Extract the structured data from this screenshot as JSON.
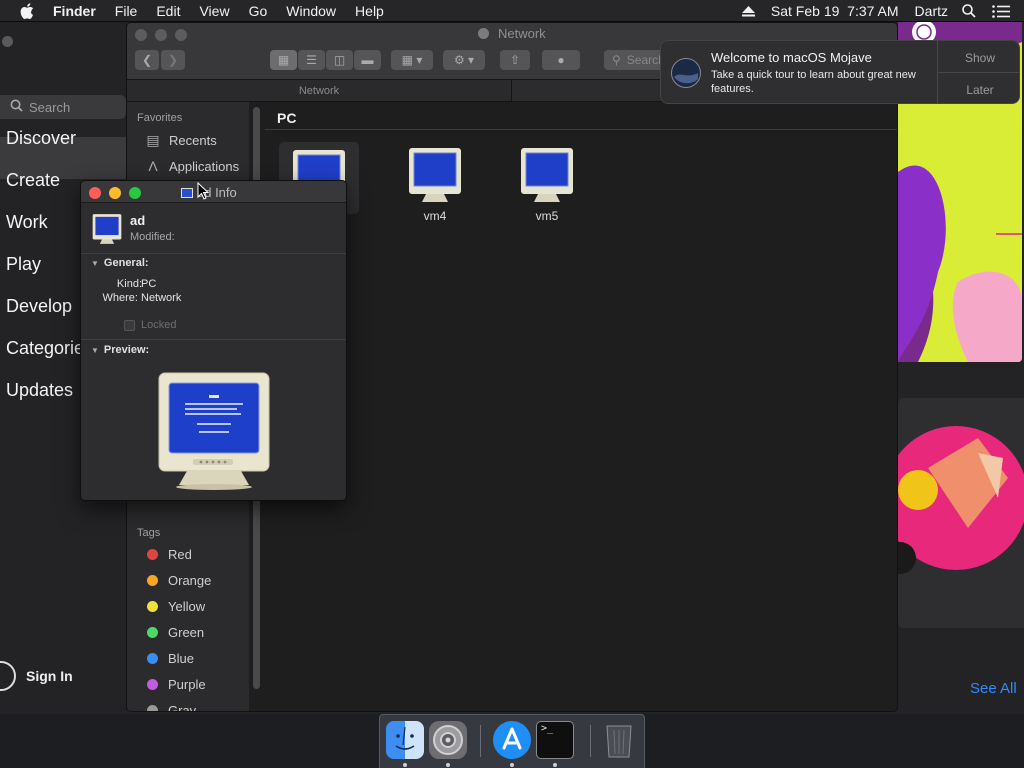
{
  "menubar": {
    "apple_icon": "apple-icon",
    "app_name": "Finder",
    "menus": [
      "File",
      "Edit",
      "View",
      "Go",
      "Window",
      "Help"
    ],
    "clock": "Sat Feb 19  7:37 AM",
    "user": "Dartz"
  },
  "appstore": {
    "search_placeholder": "Search",
    "nav": [
      "Discover",
      "Create",
      "Work",
      "Play",
      "Develop",
      "Categories",
      "Updates"
    ],
    "selected_nav": "Discover",
    "sign_in": "Sign In",
    "see_all": "See All"
  },
  "finder": {
    "title": "Network",
    "path_label": "Network",
    "search_placeholder": "Search",
    "sidebar": {
      "favorites_heading": "Favorites",
      "favorites": [
        {
          "label": "Recents",
          "icon": "recents-icon"
        },
        {
          "label": "Applications",
          "icon": "applications-icon"
        }
      ],
      "tags_heading": "Tags",
      "tags": [
        {
          "label": "Red",
          "color": "#e0443e"
        },
        {
          "label": "Orange",
          "color": "#f5a623"
        },
        {
          "label": "Yellow",
          "color": "#f1e13a"
        },
        {
          "label": "Green",
          "color": "#4cd964"
        },
        {
          "label": "Blue",
          "color": "#3a8df2"
        },
        {
          "label": "Purple",
          "color": "#c35ae0"
        },
        {
          "label": "Gray",
          "color": "#9a9a9a"
        }
      ]
    },
    "group_header": "PC",
    "items": [
      {
        "name": "ad",
        "icon": "pc-monitor-icon"
      },
      {
        "name": "vm4",
        "icon": "pc-monitor-icon"
      },
      {
        "name": "vm5",
        "icon": "pc-monitor-icon"
      }
    ]
  },
  "notification": {
    "title": "Welcome to macOS Mojave",
    "body": "Take a quick tour to learn about great new features.",
    "show_button": "Show",
    "later_button": "Later"
  },
  "info_window": {
    "title": "ad Info",
    "item_name": "ad",
    "modified_label": "Modified:",
    "general_heading": "General:",
    "kind_label": "Kind:",
    "kind_value": "PC",
    "where_label": "Where:",
    "where_value": "Network",
    "locked_label": "Locked",
    "preview_heading": "Preview:"
  },
  "dock": {
    "apps": [
      "finder-icon",
      "system-preferences-icon",
      "app-store-icon",
      "terminal-icon",
      "trash-icon"
    ]
  }
}
